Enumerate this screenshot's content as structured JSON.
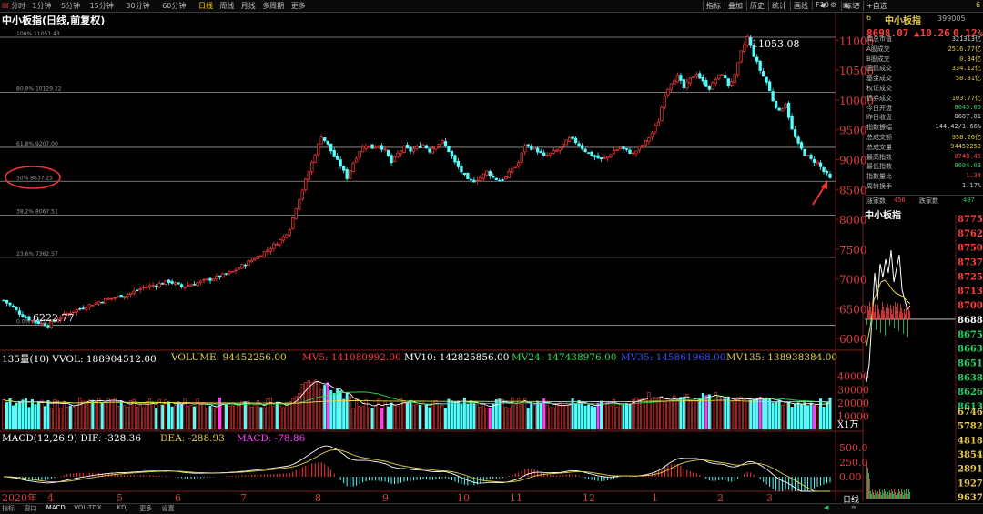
{
  "toolbar": {
    "periods": [
      {
        "label": "分时"
      },
      {
        "label": "1分钟"
      },
      {
        "label": "5分钟"
      },
      {
        "label": "15分钟"
      },
      {
        "label": "30分钟"
      },
      {
        "label": "60分钟"
      },
      {
        "label": "日线",
        "active": true
      },
      {
        "label": "周线"
      },
      {
        "label": "月线"
      },
      {
        "label": "多周期"
      },
      {
        "label": "更多"
      }
    ],
    "tools": [
      "指标",
      "叠加",
      "历史",
      "统计",
      "画线",
      "F10",
      "标记",
      "+自选"
    ],
    "right_code": "6"
  },
  "chart_title": "中小板指(日线,前复权)",
  "fib_levels": [
    {
      "label": "100% 11051.43",
      "value": 11051.43
    },
    {
      "label": "80.9% 10129.22",
      "value": 10129.22
    },
    {
      "label": "61.8% 9207.00",
      "value": 9207.0
    },
    {
      "label": "50% 8637.25",
      "value": 8637.25
    },
    {
      "label": "38.2% 8067.51",
      "value": 8067.51
    },
    {
      "label": "23.6% 7362.57",
      "value": 7362.57
    },
    {
      "label": "0.0% 6222.77",
      "value": 6222.77
    }
  ],
  "high_label": "11053.08",
  "low_label": "6222.77",
  "price_axis": {
    "ticks": [
      "11000",
      "10500",
      "10000",
      "9500",
      "9000",
      "8500",
      "8000",
      "7500",
      "7000",
      "6500",
      "6000"
    ],
    "min": 5850,
    "max": 11250
  },
  "month_labels": [
    "2020年",
    "4",
    "5",
    "6",
    "7",
    "8",
    "9",
    "10",
    "11",
    "12",
    "1",
    "2",
    "3"
  ],
  "volume_legend": {
    "prefix": "135量(10) VVOL: 188904512.00",
    "volume": "VOLUME: 94452256.00",
    "mv5": "MV5: 141080992.00",
    "mv10": "MV10: 142825856.00",
    "mv24": "MV24: 147438976.00",
    "mv35": "MV35: 145861968.00",
    "mv135": "MV135: 138938384.00"
  },
  "volume_axis": {
    "ticks": [
      "40000",
      "30000",
      "20000",
      "10000"
    ],
    "unit": "X1万"
  },
  "macd_legend": {
    "prefix": "MACD(12,26,9) DIF: -328.36",
    "dea": "DEA: -288.93",
    "macd": "MACD: -78.86"
  },
  "macd_axis": {
    "ticks": [
      "500.0",
      "250.0",
      "0.00"
    ]
  },
  "quote": {
    "name": "中小板指",
    "code": "399005",
    "price": "8698.07",
    "change": "▲10.26",
    "pct": "0.12%"
  },
  "stats": [
    {
      "label": "库总市值",
      "value": "321313亿",
      "color": "#cccccc"
    },
    {
      "label": "A股成交",
      "value": "2516.77亿",
      "color": "#e6c94a"
    },
    {
      "label": "B股成交",
      "value": "0.34亿",
      "color": "#e6c94a"
    },
    {
      "label": "国债成交",
      "value": "334.12亿",
      "color": "#e6c94a"
    },
    {
      "label": "基金成交",
      "value": "58.31亿",
      "color": "#e6c94a"
    },
    {
      "label": "权证成交",
      "value": "",
      "color": "#e6c94a"
    },
    {
      "label": "债券成交",
      "value": "103.77亿",
      "color": "#e6c94a"
    },
    {
      "label": "今日开盘",
      "value": "8645.05",
      "color": "#29d16a"
    },
    {
      "label": "昨日收盘",
      "value": "8687.81",
      "color": "#cccccc"
    },
    {
      "label": "指数振幅",
      "value": "144.42/1.66%",
      "color": "#cccccc"
    },
    {
      "label": "总成交额",
      "value": "958.26亿",
      "color": "#e6c94a"
    },
    {
      "label": "总成交量",
      "value": "94452259",
      "color": "#e6c94a"
    },
    {
      "label": "最高指数",
      "value": "8748.45",
      "color": "#ff4040"
    },
    {
      "label": "最低指数",
      "value": "8604.03",
      "color": "#29d16a"
    },
    {
      "label": "指数量比",
      "value": "1.34",
      "color": "#ff4040"
    },
    {
      "label": "周转换手",
      "value": "1.17%",
      "color": "#cccccc"
    }
  ],
  "updown": {
    "up_label": "涨家数",
    "up": "456",
    "down_label": "跌家数",
    "down": "497"
  },
  "intraday": {
    "title": "中小板指",
    "price_ticks": [
      {
        "v": "8775",
        "c": "#ff4040"
      },
      {
        "v": "8762",
        "c": "#ff4040"
      },
      {
        "v": "8750",
        "c": "#ff4040"
      },
      {
        "v": "8737",
        "c": "#ff4040"
      },
      {
        "v": "8725",
        "c": "#ff4040"
      },
      {
        "v": "8713",
        "c": "#ff4040"
      },
      {
        "v": "8700",
        "c": "#ff4040"
      },
      {
        "v": "8688",
        "c": "#ffffff"
      },
      {
        "v": "8675",
        "c": "#29d16a"
      },
      {
        "v": "8663",
        "c": "#29d16a"
      },
      {
        "v": "8651",
        "c": "#29d16a"
      },
      {
        "v": "8638",
        "c": "#29d16a"
      },
      {
        "v": "8626",
        "c": "#29d16a"
      },
      {
        "v": "8613",
        "c": "#29d16a"
      }
    ],
    "vol_ticks": [
      "674610",
      "578240",
      "481880",
      "385410",
      "289120",
      "192740",
      "96370"
    ],
    "period_label": "日线"
  },
  "bottom_tabs": [
    {
      "label": "指标"
    },
    {
      "label": "窗口"
    },
    {
      "label": "MACD",
      "active": true
    },
    {
      "label": "VOL-TDX"
    },
    {
      "label": "KDJ"
    },
    {
      "label": "更多"
    },
    {
      "label": "设置"
    }
  ],
  "colors": {
    "up": "#ff3b3b",
    "down": "#54ffff",
    "fib_line": "#9a9a9a",
    "axis": "#7a1f1f"
  },
  "chart_data": {
    "type": "candlestick",
    "title": "中小板指(日线,前复权)",
    "ylim": [
      5850,
      11250
    ],
    "x_months": [
      "2020年",
      "4",
      "5",
      "6",
      "7",
      "8",
      "9",
      "10",
      "11",
      "12",
      "1",
      "2",
      "3"
    ],
    "close_path": [
      [
        0,
        6640
      ],
      [
        3,
        6520
      ],
      [
        6,
        6380
      ],
      [
        9,
        6300
      ],
      [
        12,
        6250
      ],
      [
        14,
        6222.77
      ],
      [
        17,
        6330
      ],
      [
        20,
        6420
      ],
      [
        24,
        6500
      ],
      [
        28,
        6580
      ],
      [
        32,
        6650
      ],
      [
        36,
        6700
      ],
      [
        40,
        6760
      ],
      [
        44,
        6860
      ],
      [
        48,
        6900
      ],
      [
        52,
        6960
      ],
      [
        56,
        6870
      ],
      [
        60,
        6920
      ],
      [
        64,
        6980
      ],
      [
        68,
        7040
      ],
      [
        72,
        7120
      ],
      [
        76,
        7250
      ],
      [
        80,
        7380
      ],
      [
        84,
        7520
      ],
      [
        88,
        7700
      ],
      [
        90,
        7850
      ],
      [
        92,
        8200
      ],
      [
        94,
        8500
      ],
      [
        96,
        8800
      ],
      [
        98,
        9100
      ],
      [
        100,
        9400
      ],
      [
        102,
        9250
      ],
      [
        104,
        9050
      ],
      [
        106,
        8900
      ],
      [
        108,
        8700
      ],
      [
        110,
        8950
      ],
      [
        112,
        9150
      ],
      [
        114,
        9250
      ],
      [
        116,
        9200
      ],
      [
        118,
        9250
      ],
      [
        120,
        9150
      ],
      [
        122,
        8950
      ],
      [
        124,
        9100
      ],
      [
        126,
        9200
      ],
      [
        128,
        9150
      ],
      [
        130,
        9200
      ],
      [
        132,
        9250
      ],
      [
        134,
        9150
      ],
      [
        136,
        9250
      ],
      [
        138,
        9300
      ],
      [
        140,
        9150
      ],
      [
        142,
        8950
      ],
      [
        144,
        8800
      ],
      [
        146,
        8650
      ],
      [
        148,
        8650
      ],
      [
        150,
        8700
      ],
      [
        152,
        8800
      ],
      [
        154,
        8700
      ],
      [
        156,
        8650
      ],
      [
        158,
        8700
      ],
      [
        160,
        8850
      ],
      [
        162,
        8950
      ],
      [
        164,
        9250
      ],
      [
        166,
        9200
      ],
      [
        168,
        9150
      ],
      [
        170,
        9050
      ],
      [
        172,
        9100
      ],
      [
        174,
        9150
      ],
      [
        176,
        9250
      ],
      [
        178,
        9350
      ],
      [
        180,
        9300
      ],
      [
        182,
        9200
      ],
      [
        184,
        9100
      ],
      [
        186,
        9050
      ],
      [
        188,
        9000
      ],
      [
        190,
        9050
      ],
      [
        192,
        9150
      ],
      [
        194,
        9200
      ],
      [
        196,
        9150
      ],
      [
        198,
        9100
      ],
      [
        200,
        9200
      ],
      [
        202,
        9300
      ],
      [
        204,
        9450
      ],
      [
        206,
        9650
      ],
      [
        208,
        10100
      ],
      [
        210,
        10300
      ],
      [
        212,
        10400
      ],
      [
        214,
        10200
      ],
      [
        216,
        10350
      ],
      [
        218,
        10450
      ],
      [
        220,
        10300
      ],
      [
        222,
        10200
      ],
      [
        224,
        10350
      ],
      [
        226,
        10450
      ],
      [
        228,
        10250
      ],
      [
        230,
        10400
      ],
      [
        232,
        10800
      ],
      [
        234,
        11053.08
      ],
      [
        236,
        10750
      ],
      [
        238,
        10500
      ],
      [
        240,
        10300
      ],
      [
        242,
        10000
      ],
      [
        244,
        9800
      ],
      [
        246,
        9950
      ],
      [
        248,
        9500
      ],
      [
        250,
        9250
      ],
      [
        252,
        9100
      ],
      [
        254,
        9000
      ],
      [
        256,
        8950
      ],
      [
        258,
        8800
      ],
      [
        260,
        8698.07
      ]
    ],
    "high": 11053.08,
    "low": 6222.77
  }
}
